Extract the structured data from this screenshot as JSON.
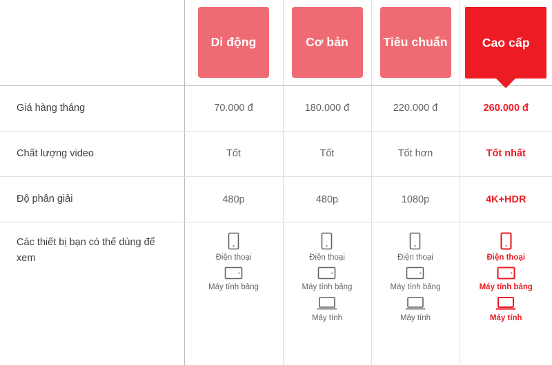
{
  "colors": {
    "accent": "#ED1B23",
    "badge_light": "#EF6B73",
    "text": "#3c4043",
    "text_muted": "#5f6368",
    "border": "#dedede"
  },
  "table": {
    "corner_label": "",
    "plans": [
      {
        "name": "Di động",
        "featured": false
      },
      {
        "name": "Cơ bản",
        "featured": false
      },
      {
        "name": "Tiêu chuẩn",
        "featured": false
      },
      {
        "name": "Cao cấp",
        "featured": true
      }
    ],
    "rows": [
      {
        "label": "Giá hàng tháng",
        "values": [
          "70.000 đ",
          "180.000 đ",
          "220.000 đ",
          "260.000 đ"
        ]
      },
      {
        "label": "Chất lượng video",
        "values": [
          "Tốt",
          "Tốt",
          "Tốt hơn",
          "Tốt nhất"
        ]
      },
      {
        "label": "Độ phân giải",
        "values": [
          "480p",
          "480p",
          "1080p",
          "4K+HDR"
        ]
      }
    ],
    "devices_row": {
      "label": "Các thiết bị bạn có thể dùng để xem",
      "columns": [
        {
          "devices": [
            {
              "icon": "phone-icon",
              "label": "Điện thoại"
            },
            {
              "icon": "tablet-icon",
              "label": "Máy tính bảng"
            }
          ]
        },
        {
          "devices": [
            {
              "icon": "phone-icon",
              "label": "Điện thoại"
            },
            {
              "icon": "tablet-icon",
              "label": "Máy tính bảng"
            },
            {
              "icon": "laptop-icon",
              "label": "Máy tính"
            }
          ]
        },
        {
          "devices": [
            {
              "icon": "phone-icon",
              "label": "Điện thoại"
            },
            {
              "icon": "tablet-icon",
              "label": "Máy tính bảng"
            },
            {
              "icon": "laptop-icon",
              "label": "Máy tính"
            }
          ]
        },
        {
          "devices": [
            {
              "icon": "phone-icon",
              "label": "Điện thoại"
            },
            {
              "icon": "tablet-icon",
              "label": "Máy tính bảng"
            },
            {
              "icon": "laptop-icon",
              "label": "Máy tính"
            }
          ]
        }
      ]
    }
  }
}
